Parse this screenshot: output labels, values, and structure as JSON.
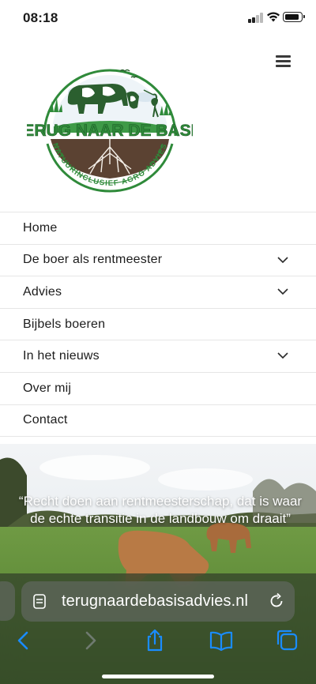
{
  "status_bar": {
    "time": "08:18"
  },
  "logo": {
    "title": "TERUG NAAR DE BASIS",
    "subtitle": "NATUURINCLUSIEF AGRO ADVIES"
  },
  "menu": {
    "items": [
      {
        "label": "Home",
        "has_submenu": false
      },
      {
        "label": "De boer als rentmeester",
        "has_submenu": true
      },
      {
        "label": "Advies",
        "has_submenu": true
      },
      {
        "label": "Bijbels boeren",
        "has_submenu": false
      },
      {
        "label": "In het nieuws",
        "has_submenu": true
      },
      {
        "label": "Over mij",
        "has_submenu": false
      },
      {
        "label": "Contact",
        "has_submenu": false
      }
    ]
  },
  "hero": {
    "quote": "“Recht doen aan rentmeesterschap, dat is waar de echte transitie in de landbouw om draait”"
  },
  "browser": {
    "url": "terugnaardebasisadvies.nl",
    "accent_color": "#1a8cff"
  },
  "colors": {
    "brand_green": "#2f8a3a",
    "soil_brown": "#5b4232"
  }
}
